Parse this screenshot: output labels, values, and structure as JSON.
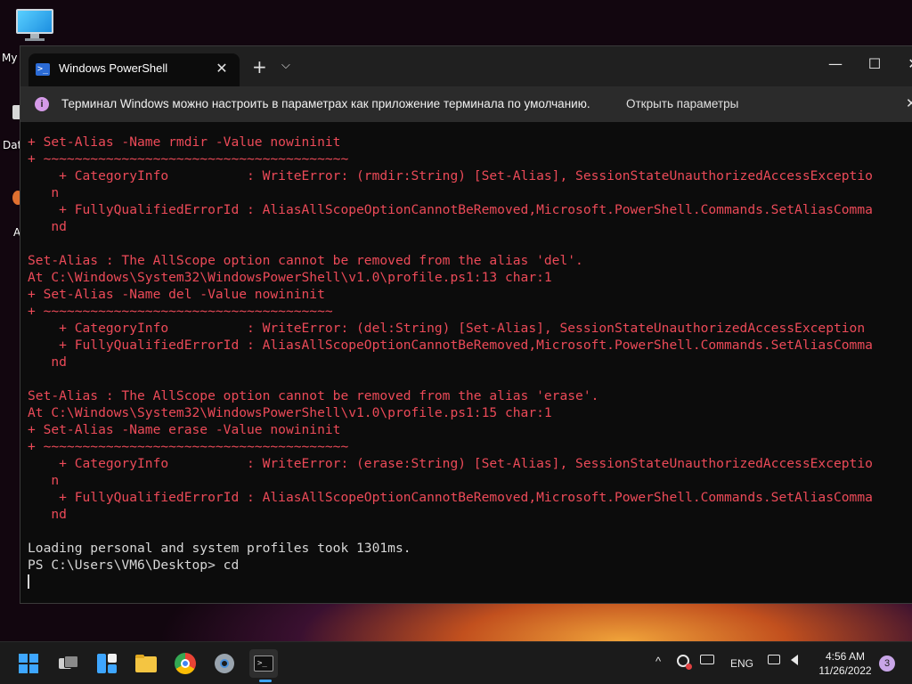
{
  "desktop": {
    "icon_label_1": "My",
    "icon_label_2": "Dat",
    "icon_label_3": "A"
  },
  "window": {
    "tab_title": "Windows PowerShell",
    "tab_close": "✕",
    "new_tab": "+",
    "dropdown": "⌵",
    "minimize": "—",
    "maximize": "☐",
    "close": "✕"
  },
  "infobar": {
    "icon": "i",
    "message": "Терминал Windows можно настроить в параметрах как приложение терминала по умолчанию.",
    "link": "Открыть параметры",
    "close": "✕"
  },
  "console": {
    "lines": [
      {
        "type": "err",
        "text": "+ Set-Alias -Name rmdir -Value nowininit"
      },
      {
        "type": "err",
        "text": "+ ~~~~~~~~~~~~~~~~~~~~~~~~~~~~~~~~~~~~~~~"
      },
      {
        "type": "err",
        "text": "    + CategoryInfo          : WriteError: (rmdir:String) [Set-Alias], SessionStateUnauthorizedAccessExceptio"
      },
      {
        "type": "err",
        "text": "   n"
      },
      {
        "type": "err",
        "text": "    + FullyQualifiedErrorId : AliasAllScopeOptionCannotBeRemoved,Microsoft.PowerShell.Commands.SetAliasComma"
      },
      {
        "type": "err",
        "text": "   nd"
      },
      {
        "type": "err",
        "text": ""
      },
      {
        "type": "err",
        "text": "Set-Alias : The AllScope option cannot be removed from the alias 'del'."
      },
      {
        "type": "err",
        "text": "At C:\\Windows\\System32\\WindowsPowerShell\\v1.0\\profile.ps1:13 char:1"
      },
      {
        "type": "err",
        "text": "+ Set-Alias -Name del -Value nowininit"
      },
      {
        "type": "err",
        "text": "+ ~~~~~~~~~~~~~~~~~~~~~~~~~~~~~~~~~~~~~"
      },
      {
        "type": "err",
        "text": "    + CategoryInfo          : WriteError: (del:String) [Set-Alias], SessionStateUnauthorizedAccessException"
      },
      {
        "type": "err",
        "text": "    + FullyQualifiedErrorId : AliasAllScopeOptionCannotBeRemoved,Microsoft.PowerShell.Commands.SetAliasComma"
      },
      {
        "type": "err",
        "text": "   nd"
      },
      {
        "type": "err",
        "text": ""
      },
      {
        "type": "err",
        "text": "Set-Alias : The AllScope option cannot be removed from the alias 'erase'."
      },
      {
        "type": "err",
        "text": "At C:\\Windows\\System32\\WindowsPowerShell\\v1.0\\profile.ps1:15 char:1"
      },
      {
        "type": "err",
        "text": "+ Set-Alias -Name erase -Value nowininit"
      },
      {
        "type": "err",
        "text": "+ ~~~~~~~~~~~~~~~~~~~~~~~~~~~~~~~~~~~~~~~"
      },
      {
        "type": "err",
        "text": "    + CategoryInfo          : WriteError: (erase:String) [Set-Alias], SessionStateUnauthorizedAccessExceptio"
      },
      {
        "type": "err",
        "text": "   n"
      },
      {
        "type": "err",
        "text": "    + FullyQualifiedErrorId : AliasAllScopeOptionCannotBeRemoved,Microsoft.PowerShell.Commands.SetAliasComma"
      },
      {
        "type": "err",
        "text": "   nd"
      },
      {
        "type": "err",
        "text": ""
      },
      {
        "type": "norm",
        "text": "Loading personal and system profiles took 1301ms."
      },
      {
        "type": "norm",
        "text": "PS C:\\Users\\VM6\\Desktop> cd"
      }
    ]
  },
  "taskbar": {
    "apps": [
      "start-icon",
      "task-view-icon",
      "widgets-icon",
      "file-explorer-icon",
      "chrome-icon",
      "settings-icon",
      "terminal-icon"
    ],
    "tray_chevron": "^",
    "language": "ENG",
    "time": "4:56 AM",
    "date": "11/26/2022",
    "notifications": "3",
    "accent_color": "#3ea6ff"
  },
  "colors": {
    "error_text": "#ec4a58",
    "normal_text": "#d6d6d6",
    "console_bg": "#0c0c0c"
  }
}
